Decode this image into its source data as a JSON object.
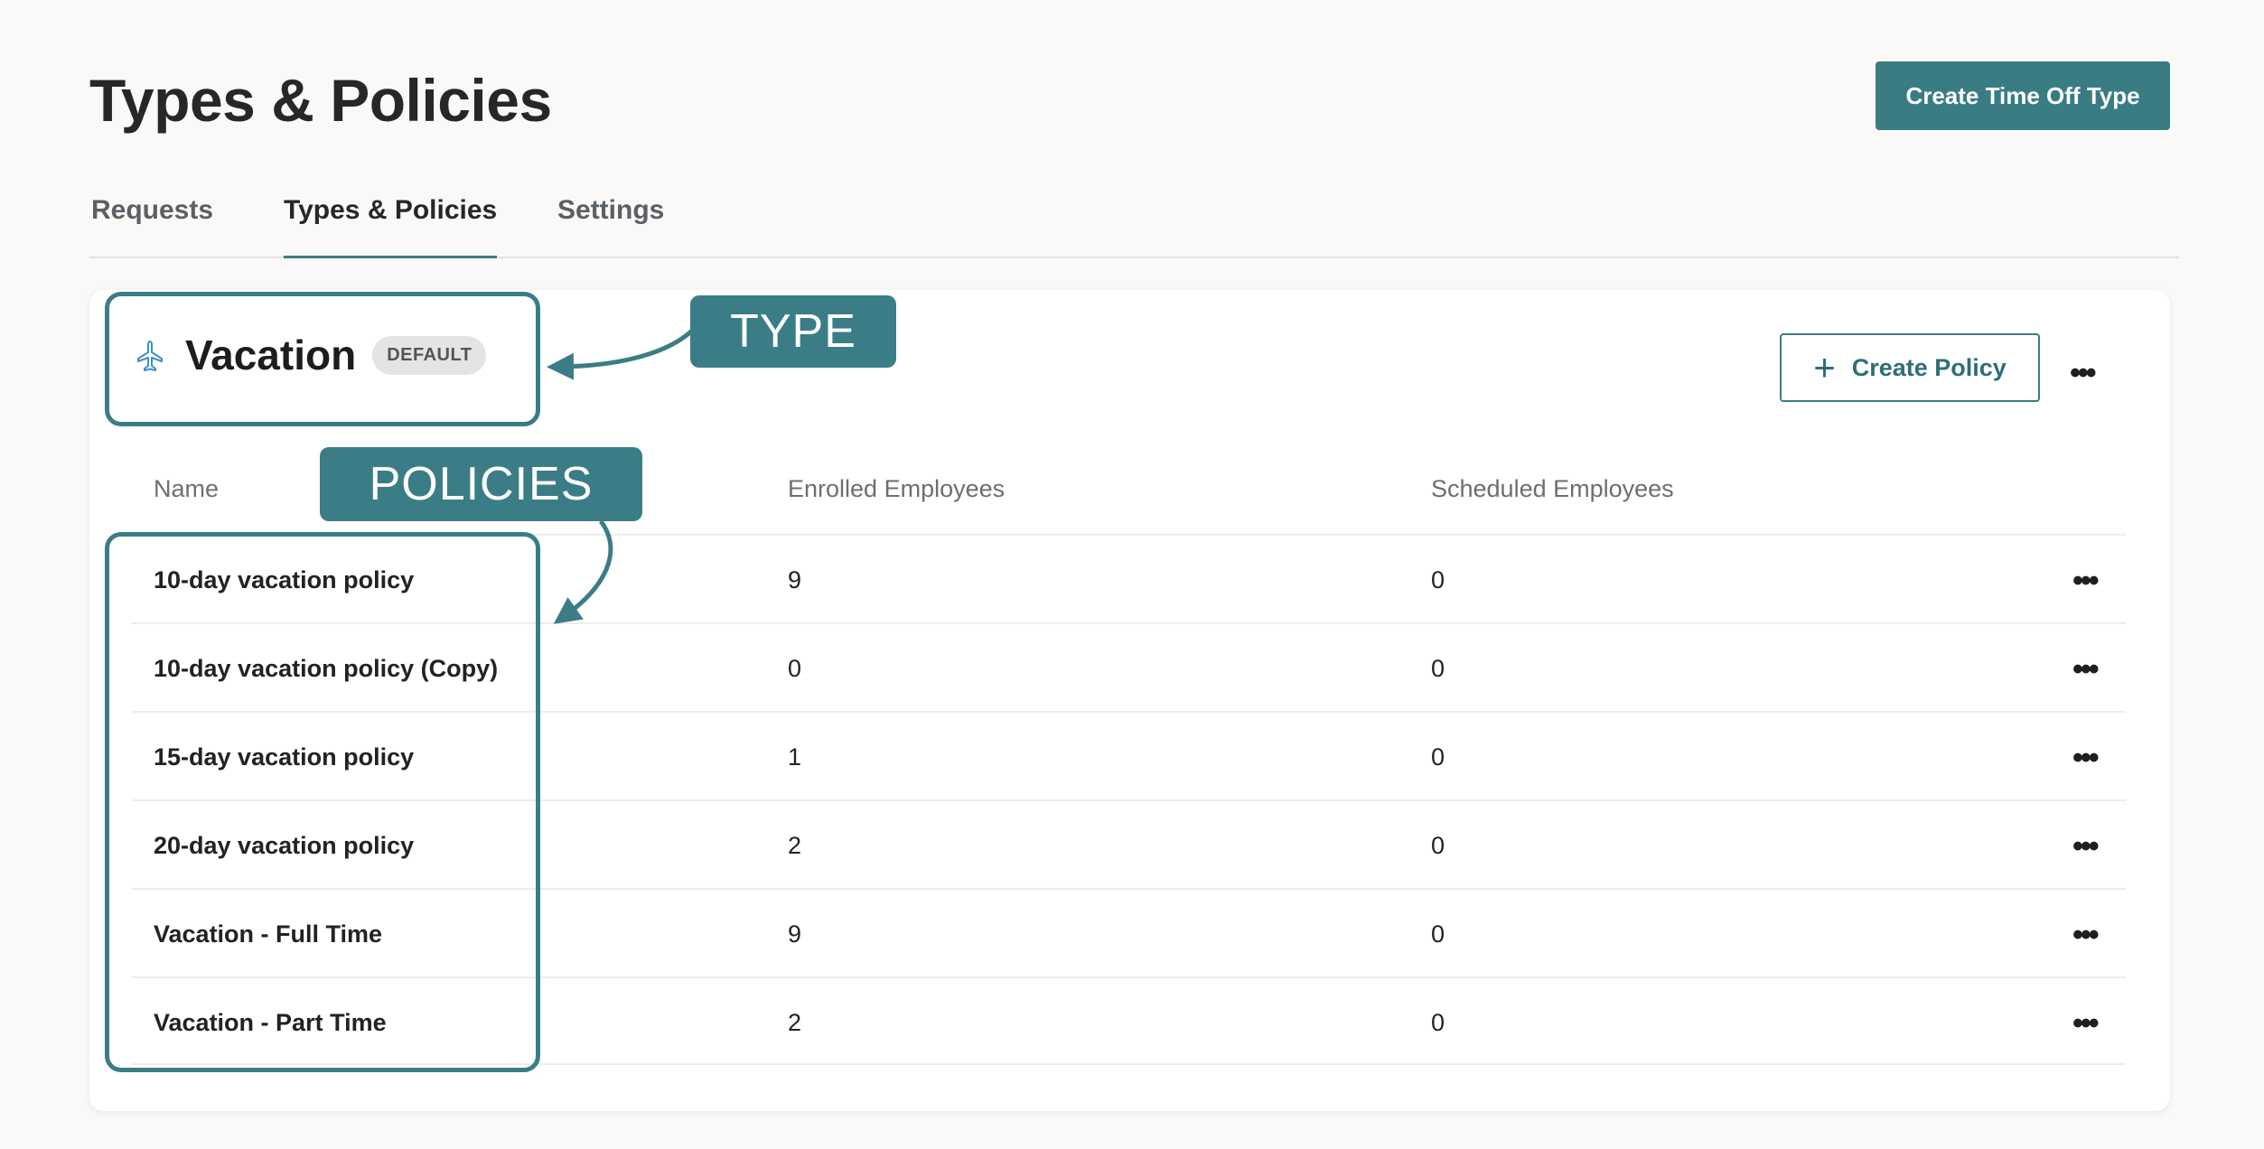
{
  "page": {
    "title": "Types & Policies",
    "create_type_label": "Create Time Off Type"
  },
  "tabs": [
    {
      "label": "Requests"
    },
    {
      "label": "Types & Policies",
      "active": true
    },
    {
      "label": "Settings"
    }
  ],
  "type_card": {
    "icon": "airplane-icon",
    "name": "Vacation",
    "badge": "DEFAULT",
    "create_policy_label": "Create Policy",
    "more_label": "•••"
  },
  "table": {
    "headers": {
      "name": "Name",
      "enrolled": "Enrolled Employees",
      "scheduled": "Scheduled Employees"
    },
    "rows": [
      {
        "name": "10-day vacation policy",
        "enrolled": "9",
        "scheduled": "0"
      },
      {
        "name": "10-day vacation policy (Copy)",
        "enrolled": "0",
        "scheduled": "0"
      },
      {
        "name": "15-day vacation policy",
        "enrolled": "1",
        "scheduled": "0"
      },
      {
        "name": "20-day vacation policy",
        "enrolled": "2",
        "scheduled": "0"
      },
      {
        "name": "Vacation - Full Time",
        "enrolled": "9",
        "scheduled": "0"
      },
      {
        "name": "Vacation - Part Time",
        "enrolled": "2",
        "scheduled": "0"
      }
    ],
    "row_menu_label": "•••"
  },
  "annotations": {
    "type_label": "TYPE",
    "policies_label": "POLICIES",
    "color": "#3b7d86"
  },
  "colors": {
    "accent": "#3a7c83",
    "background": "#faf9f7"
  }
}
